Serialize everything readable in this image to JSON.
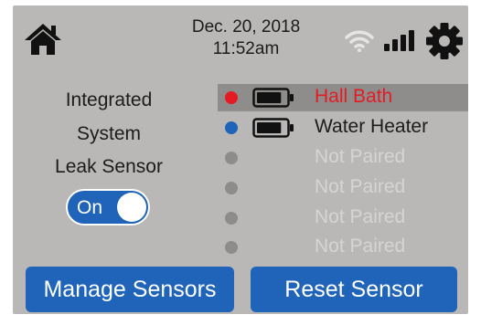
{
  "status_bar": {
    "date": "Dec. 20, 2018",
    "time": "11:52am",
    "icons": [
      "home-icon",
      "wifi-icon",
      "signal-icon",
      "gear-icon"
    ]
  },
  "left_panel": {
    "title_lines": [
      "Integrated",
      "System",
      "Leak Sensor"
    ],
    "toggle": {
      "label": "On",
      "state": true
    }
  },
  "sensors": [
    {
      "name": "Hall Bath",
      "dot_color": "#e51b24",
      "text_color": "#e51b24",
      "battery": true,
      "battery_level": 0.85,
      "selected": true
    },
    {
      "name": "Water Heater",
      "dot_color": "#1f64b8",
      "text_color": "#1c1c1c",
      "battery": true,
      "battery_level": 0.85,
      "selected": false
    },
    {
      "name": "Not Paired",
      "dot_color": "#8d8c8a",
      "text_color": "#d6d5d3",
      "battery": false,
      "selected": false
    },
    {
      "name": "Not Paired",
      "dot_color": "#8d8c8a",
      "text_color": "#d6d5d3",
      "battery": false,
      "selected": false
    },
    {
      "name": "Not Paired",
      "dot_color": "#8d8c8a",
      "text_color": "#d6d5d3",
      "battery": false,
      "selected": false
    },
    {
      "name": "Not Paired",
      "dot_color": "#8d8c8a",
      "text_color": "#d6d5d3",
      "battery": false,
      "selected": false
    }
  ],
  "buttons": {
    "manage": "Manage Sensors",
    "reset": "Reset Sensor"
  },
  "colors": {
    "panel_bg": "#b9b8b6",
    "accent": "#1f64b8",
    "alert": "#e51b24",
    "highlight": "#8e8d8b"
  }
}
